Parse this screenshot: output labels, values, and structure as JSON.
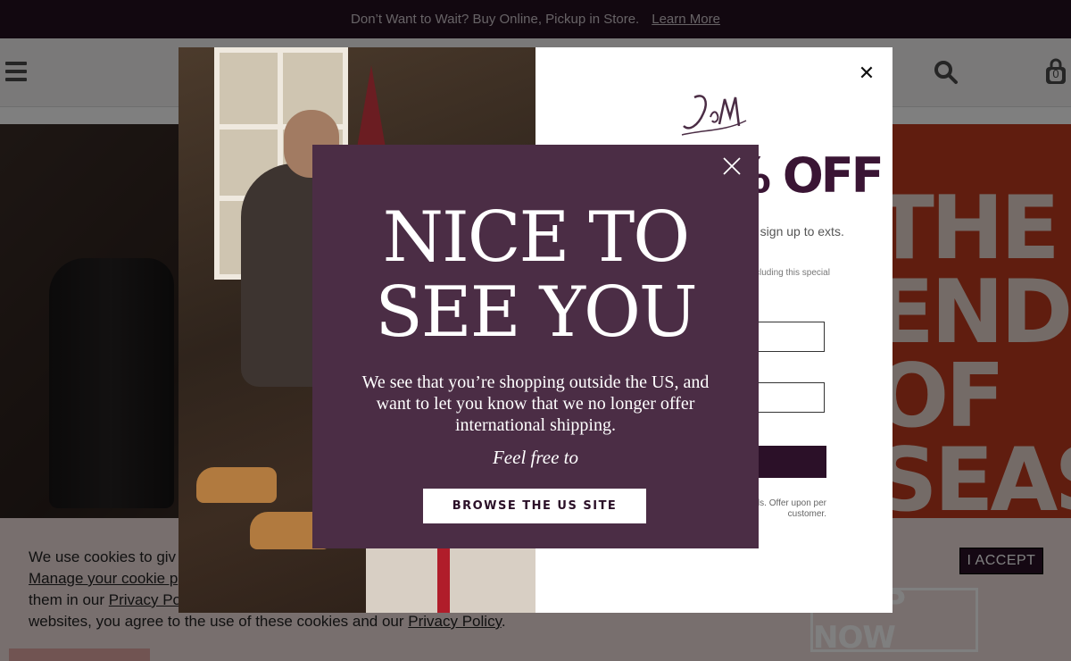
{
  "announcement": {
    "text": "Don’t Want to Wait? Buy Online, Pickup in Store.",
    "link": "Learn More"
  },
  "header": {
    "bag_count": "0"
  },
  "hero": {
    "sale_text": "THE END OF SEASON SALE"
  },
  "cookie": {
    "line1_start": "We use cookies to giv",
    "manage_link": "Manage your cookie p",
    "line3_start": "them in our ",
    "privacy_link_partial": "Privacy Po",
    "line4_text": "websites, you agree to the use of these cookies and our ",
    "privacy_link": "Privacy Policy",
    "line4_end": ".",
    "accept_label": "I ACCEPT",
    "shop_now": "SHOP NOW"
  },
  "signup_modal": {
    "logo_text": "JM",
    "heading_visible": "% OFF",
    "text_visible": "u sign up to exts.",
    "small_visible": "cluding this special",
    "submit_visible": "",
    "legal_visible": "essage frequency cancel. See or details. Offer upon per customer."
  },
  "intl_popup": {
    "heading_line1": "NICE TO",
    "heading_line2": "SEE YOU",
    "body": "We see that you’re shopping outside the US, and want to let you know that we no longer offer international shipping.",
    "feel_free": "Feel free to",
    "browse_button": "BROWSE THE US SITE"
  },
  "colors": {
    "announcement_bg": "#241021",
    "popup_bg": "#4b2d45",
    "brand_plum": "#2b1028",
    "sale_red": "#c13b1e"
  }
}
